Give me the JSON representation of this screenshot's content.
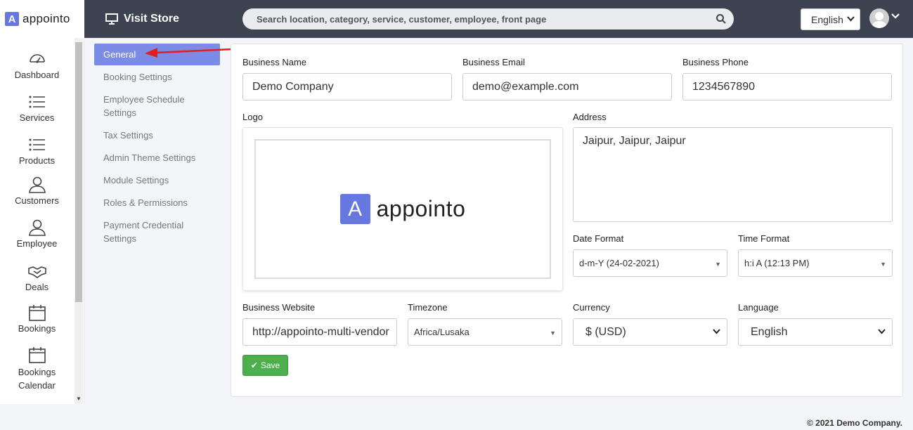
{
  "brand": {
    "mark": "A",
    "name": "appointo"
  },
  "topbar": {
    "visit_store": "Visit Store",
    "search_placeholder": "Search location, category, service, customer, employee, front page",
    "language": "English"
  },
  "sidebar": {
    "items": [
      {
        "label": "Dashboard",
        "icon": "dashboard-icon"
      },
      {
        "label": "Services",
        "icon": "list-icon"
      },
      {
        "label": "Products",
        "icon": "list-icon"
      },
      {
        "label": "Customers",
        "icon": "user-icon"
      },
      {
        "label": "Employee",
        "icon": "user-icon"
      },
      {
        "label": "Deals",
        "icon": "handshake-icon"
      },
      {
        "label": "Bookings",
        "icon": "calendar-icon"
      },
      {
        "label": "Bookings Calendar",
        "icon": "calendar-icon"
      }
    ]
  },
  "settings_menu": {
    "items": [
      {
        "label": "General",
        "active": true
      },
      {
        "label": "Booking Settings"
      },
      {
        "label": "Employee Schedule Settings"
      },
      {
        "label": "Tax Settings"
      },
      {
        "label": "Admin Theme Settings"
      },
      {
        "label": "Module Settings"
      },
      {
        "label": "Roles & Permissions"
      },
      {
        "label": "Payment Credential Settings"
      }
    ]
  },
  "form": {
    "business_name": {
      "label": "Business Name",
      "value": "Demo Company"
    },
    "business_email": {
      "label": "Business Email",
      "value": "demo@example.com"
    },
    "business_phone": {
      "label": "Business Phone",
      "value": "1234567890"
    },
    "logo": {
      "label": "Logo",
      "mark": "A",
      "text": "appointo"
    },
    "address": {
      "label": "Address",
      "value": "Jaipur, Jaipur, Jaipur"
    },
    "date_format": {
      "label": "Date Format",
      "value": "d-m-Y (24-02-2021)"
    },
    "time_format": {
      "label": "Time Format",
      "value": "h:i A (12:13 PM)"
    },
    "business_website": {
      "label": "Business Website",
      "value": "http://appointo-multi-vendor"
    },
    "timezone": {
      "label": "Timezone",
      "value": "Africa/Lusaka"
    },
    "currency": {
      "label": "Currency",
      "value": "$ (USD)"
    },
    "language": {
      "label": "Language",
      "value": "English"
    },
    "save_label": "Save"
  },
  "footer": {
    "text": "© 2021 Demo Company."
  },
  "colors": {
    "topbar": "#3d4351",
    "accent": "#7c8be3",
    "brand": "#6677e0",
    "save": "#4cae4c",
    "arrow": "#e02020"
  }
}
